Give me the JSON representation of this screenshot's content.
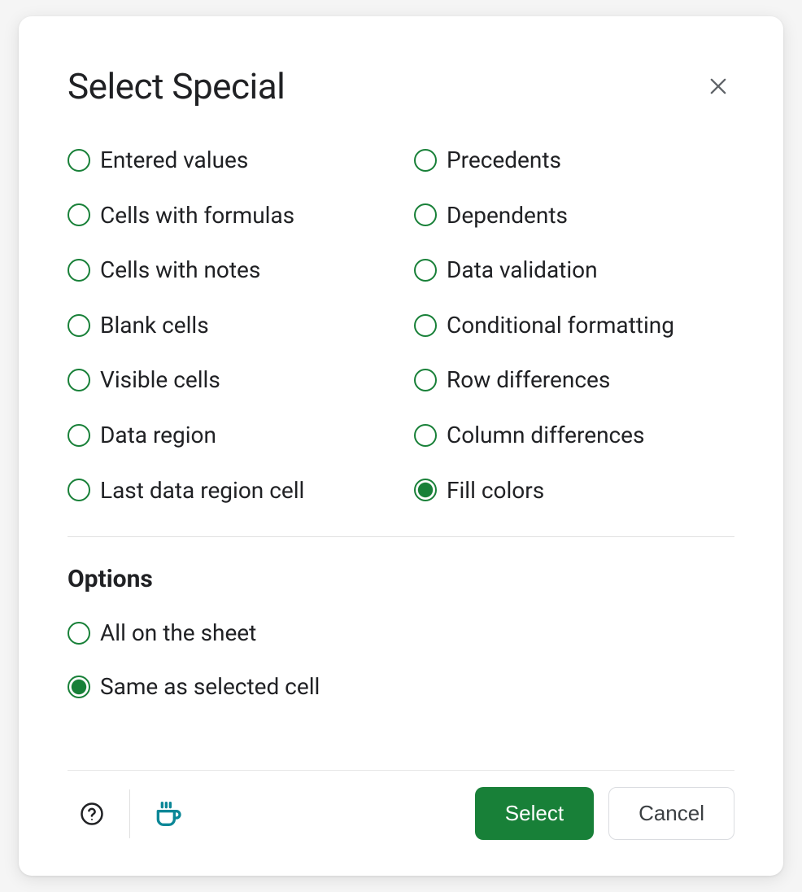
{
  "dialog": {
    "title": "Select Special",
    "radios": {
      "left": [
        {
          "id": "entered-values",
          "label": "Entered values",
          "selected": false
        },
        {
          "id": "cells-with-formulas",
          "label": "Cells with formulas",
          "selected": false
        },
        {
          "id": "cells-with-notes",
          "label": "Cells with notes",
          "selected": false
        },
        {
          "id": "blank-cells",
          "label": "Blank cells",
          "selected": false
        },
        {
          "id": "visible-cells",
          "label": "Visible cells",
          "selected": false
        },
        {
          "id": "data-region",
          "label": "Data region",
          "selected": false
        },
        {
          "id": "last-data-region-cell",
          "label": "Last data region cell",
          "selected": false
        }
      ],
      "right": [
        {
          "id": "precedents",
          "label": "Precedents",
          "selected": false
        },
        {
          "id": "dependents",
          "label": "Dependents",
          "selected": false
        },
        {
          "id": "data-validation",
          "label": "Data validation",
          "selected": false
        },
        {
          "id": "conditional-formatting",
          "label": "Conditional formatting",
          "selected": false
        },
        {
          "id": "row-differences",
          "label": "Row differences",
          "selected": false
        },
        {
          "id": "column-differences",
          "label": "Column differences",
          "selected": false
        },
        {
          "id": "fill-colors",
          "label": "Fill colors",
          "selected": true
        }
      ]
    },
    "options": {
      "heading": "Options",
      "items": [
        {
          "id": "all-on-sheet",
          "label": "All on the sheet",
          "selected": false
        },
        {
          "id": "same-as-selected-cell",
          "label": "Same as selected cell",
          "selected": true
        }
      ]
    },
    "footer": {
      "primary_label": "Select",
      "secondary_label": "Cancel"
    }
  }
}
